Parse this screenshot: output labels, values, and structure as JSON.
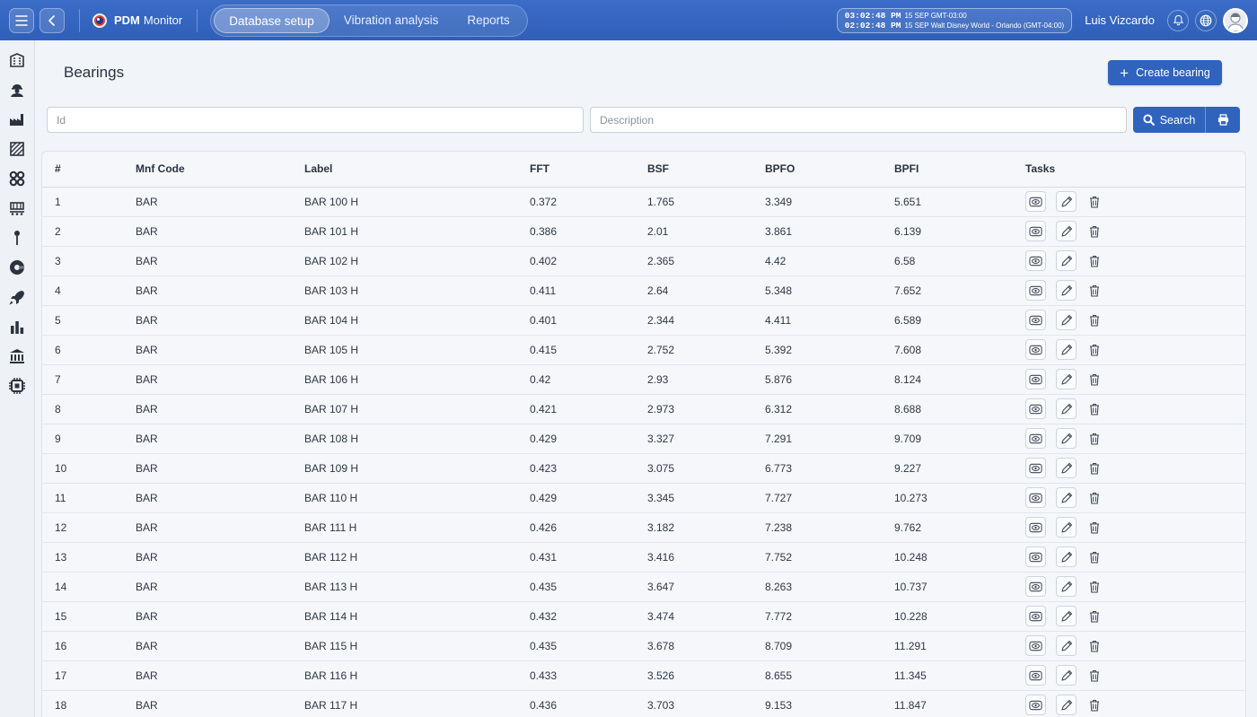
{
  "header": {
    "brand_bold": "PDM",
    "brand_rest": "Monitor",
    "tabs": [
      {
        "label": "Database setup",
        "active": true
      },
      {
        "label": "Vibration analysis",
        "active": false
      },
      {
        "label": "Reports",
        "active": false
      }
    ],
    "clock": {
      "local_time": "03:02:48 PM",
      "local_date": "15 SEP",
      "local_zone": "GMT-03:00",
      "remote_time": "02:02:48 PM",
      "remote_date": "15 SEP",
      "remote_zone": "Walt Disney World - Orlando (GMT-04:00)"
    },
    "user_name": "Luis Vizcardo"
  },
  "sidebar": {
    "icons": [
      "building-icon",
      "worker-icon",
      "factory-icon",
      "hatch-icon",
      "gears-icon",
      "conveyor-icon",
      "pin-icon",
      "turbine-icon",
      "rocket-icon",
      "bar-chart-icon",
      "bank-icon",
      "chip-icon"
    ]
  },
  "page": {
    "title": "Bearings",
    "create_label": "Create bearing",
    "id_placeholder": "Id",
    "description_placeholder": "Description",
    "search_label": "Search"
  },
  "table": {
    "headers": [
      "#",
      "Mnf Code",
      "Label",
      "FFT",
      "BSF",
      "BPFO",
      "BPFI",
      "Tasks"
    ],
    "rows": [
      [
        "1",
        "BAR",
        "BAR 100 H",
        "0.372",
        "1.765",
        "3.349",
        "5.651"
      ],
      [
        "2",
        "BAR",
        "BAR 101 H",
        "0.386",
        "2.01",
        "3.861",
        "6.139"
      ],
      [
        "3",
        "BAR",
        "BAR 102 H",
        "0.402",
        "2.365",
        "4.42",
        "6.58"
      ],
      [
        "4",
        "BAR",
        "BAR 103 H",
        "0.411",
        "2.64",
        "5.348",
        "7.652"
      ],
      [
        "5",
        "BAR",
        "BAR 104 H",
        "0.401",
        "2.344",
        "4.411",
        "6.589"
      ],
      [
        "6",
        "BAR",
        "BAR 105 H",
        "0.415",
        "2.752",
        "5.392",
        "7.608"
      ],
      [
        "7",
        "BAR",
        "BAR 106 H",
        "0.42",
        "2.93",
        "5.876",
        "8.124"
      ],
      [
        "8",
        "BAR",
        "BAR 107 H",
        "0.421",
        "2.973",
        "6.312",
        "8.688"
      ],
      [
        "9",
        "BAR",
        "BAR 108 H",
        "0.429",
        "3.327",
        "7.291",
        "9.709"
      ],
      [
        "10",
        "BAR",
        "BAR 109 H",
        "0.423",
        "3.075",
        "6.773",
        "9.227"
      ],
      [
        "11",
        "BAR",
        "BAR 110 H",
        "0.429",
        "3.345",
        "7.727",
        "10.273"
      ],
      [
        "12",
        "BAR",
        "BAR 111 H",
        "0.426",
        "3.182",
        "7.238",
        "9.762"
      ],
      [
        "13",
        "BAR",
        "BAR 112 H",
        "0.431",
        "3.416",
        "7.752",
        "10.248"
      ],
      [
        "14",
        "BAR",
        "BAR 113 H",
        "0.435",
        "3.647",
        "8.263",
        "10.737"
      ],
      [
        "15",
        "BAR",
        "BAR 114 H",
        "0.432",
        "3.474",
        "7.772",
        "10.228"
      ],
      [
        "16",
        "BAR",
        "BAR 115 H",
        "0.435",
        "3.678",
        "8.709",
        "11.291"
      ],
      [
        "17",
        "BAR",
        "BAR 116 H",
        "0.433",
        "3.526",
        "8.655",
        "11.345"
      ],
      [
        "18",
        "BAR",
        "BAR 117 H",
        "0.436",
        "3.703",
        "9.153",
        "11.847"
      ]
    ]
  },
  "colors": {
    "header_blue": "#2f5fb8",
    "primary": "#2f63bd"
  }
}
